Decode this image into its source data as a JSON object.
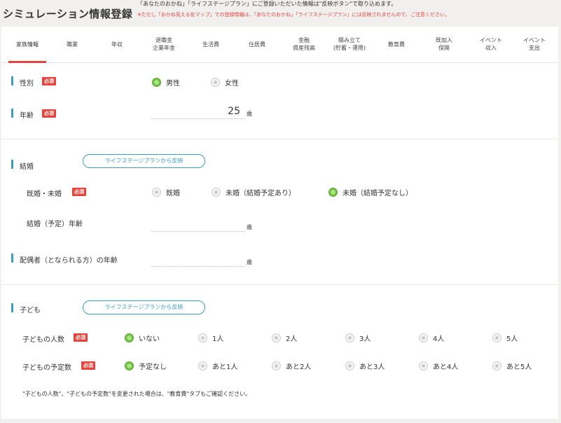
{
  "header": {
    "title": "シミュレーション情報登録",
    "note_main": "「あなたのおかね」「ライフステージプラン」にご登録いただいた情報は\"反映ボタン\"で取り込めます。",
    "note_warning": "※ただし「おかね見える化マップ」での登録情報は、「あなたのおかね」「ライフステージプラン」には反映されませんので、ご注意ください。"
  },
  "tabs": [
    {
      "line1": "家族情報",
      "line2": ""
    },
    {
      "line1": "職業",
      "line2": ""
    },
    {
      "line1": "年収",
      "line2": ""
    },
    {
      "line1": "退職金",
      "line2": "企業年金"
    },
    {
      "line1": "生活費",
      "line2": ""
    },
    {
      "line1": "住居費",
      "line2": ""
    },
    {
      "line1": "金融",
      "line2": "資産残高"
    },
    {
      "line1": "積み立て",
      "line2": "(貯蓄・運用)"
    },
    {
      "line1": "教育費",
      "line2": ""
    },
    {
      "line1": "既加入",
      "line2": "保険"
    },
    {
      "line1": "イベント",
      "line2": "収入"
    },
    {
      "line1": "イベント",
      "line2": "支出"
    }
  ],
  "required_badge": "必須",
  "reflect_button": "ライフステージプランから反映",
  "gender": {
    "label": "性別",
    "options": [
      "男性",
      "女性"
    ],
    "selected": "男性"
  },
  "age": {
    "label": "年齢",
    "value": "25",
    "unit": "歳"
  },
  "marriage": {
    "label": "結婚",
    "status_label": "既婚・未婚",
    "options": [
      "既婚",
      "未婚（結婚予定あり）",
      "未婚（結婚予定なし）"
    ],
    "selected": "未婚（結婚予定なし）",
    "planned_age_label": "結婚（予定）年齢",
    "planned_age_value": "",
    "unit": "歳"
  },
  "spouse": {
    "label": "配偶者（となられる方）の年齢",
    "value": "",
    "unit": "歳"
  },
  "children": {
    "label": "子ども",
    "count_label": "子どもの人数",
    "count_options": [
      "いない",
      "1人",
      "2人",
      "3人",
      "4人",
      "5人"
    ],
    "count_selected": "いない",
    "planned_label": "子どもの予定数",
    "planned_options": [
      "予定なし",
      "あと1人",
      "あと2人",
      "あと3人",
      "あと4人",
      "あと5人"
    ],
    "planned_selected": "予定なし",
    "footnote": "\"子どもの人数\"、\"子どもの予定数\"を変更された場合は、\"教育費\"タブもご確認ください。"
  },
  "colors": {
    "accent_red": "#e8433a",
    "accent_blue": "#3a9fbf",
    "radio_green": "#8bd35c"
  }
}
